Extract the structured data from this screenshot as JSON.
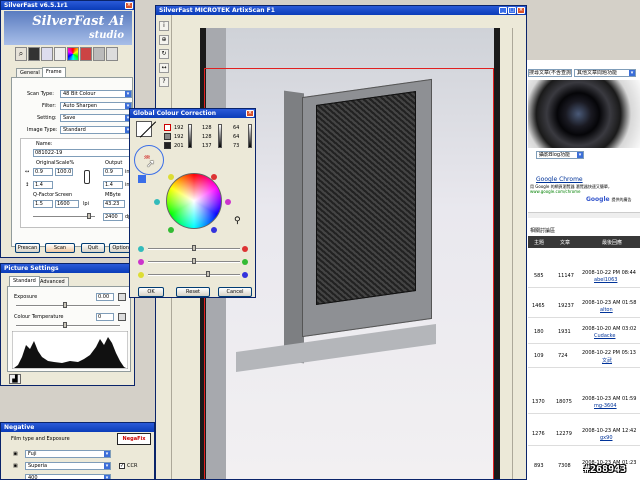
{
  "silverfast": {
    "title": "SilverFast v6.5.1r1",
    "logo_main": "SilverFast Ai",
    "logo_sub": "studio",
    "tabs": [
      "General",
      "Frame"
    ],
    "fields": [
      {
        "label": "Scan Type:",
        "value": "48 Bit Colour"
      },
      {
        "label": "Filter:",
        "value": "Auto Sharpen"
      },
      {
        "label": "Setting:",
        "value": "Save"
      },
      {
        "label": "Image Type:",
        "value": "Standard"
      }
    ],
    "name_label": "Name:",
    "name_value": "081022-19",
    "original_label": "Original",
    "scale_label": "Scale%",
    "output_label": "Output",
    "orig_w": "0.9",
    "scale_val": "100.0",
    "out_w": "0.9",
    "orig_h": "1.4",
    "out_h": "1.4",
    "unit": "inch",
    "qfactor_label": "Q-Factor",
    "screen_label": "Screen",
    "mbyte_label": "MByte",
    "qfactor": "1.5",
    "screen": "1600",
    "lpi": "lpi",
    "mbyte": "43.23",
    "dpi_val": "2400",
    "dpi": "dpi",
    "buttons": [
      "Prescan",
      "Scan",
      "Quit",
      "Options"
    ]
  },
  "picture_settings": {
    "title": "Picture Settings",
    "tabs": [
      "Standard",
      "Advanced"
    ],
    "exposure_label": "Exposure",
    "exposure_value": "0.00",
    "temp_label": "Colour Temperature",
    "temp_value": "0"
  },
  "negative": {
    "title": "Negative",
    "section": "Film type and Exposure",
    "brand": "NegaFix",
    "maker": "Fuji",
    "film": "Superia",
    "ccr": "CCR",
    "third": "400"
  },
  "prescan": {
    "title": "SilverFast MICROTEK ArtixScan F1"
  },
  "gcc": {
    "title": "Global Colour Correction",
    "rows": [
      [
        "192",
        "128",
        "64"
      ],
      [
        "192",
        "128",
        "64"
      ],
      [
        "201",
        "137",
        "73"
      ]
    ],
    "buttons": [
      "OK",
      "Reset",
      "Cancel"
    ]
  },
  "browser": {
    "search_box": "搜尋文章(不含查詢)",
    "search_option": "其他文章問題功能",
    "select_label": "攝影Blog功能",
    "google_title": "Google Chrome",
    "google_line1": "用 Google 的網頁瀏覽器 瀏覽器快速又簡單，",
    "google_line2": "www.google.com/chrome",
    "google_brand": "Google",
    "google_ad": "提供的廣告",
    "section_title": "相關討論區",
    "headers": [
      "主題",
      "文章",
      "最後回應"
    ],
    "rows": [
      {
        "a": "585",
        "b": "11147",
        "date": "2008-10-22 PM 08:44",
        "user": "abel1063"
      },
      {
        "a": "1465",
        "b": "19237",
        "date": "2008-10-23 AM 01:58",
        "user": "alton"
      },
      {
        "a": "180",
        "b": "1931",
        "date": "2008-10-20 AM 03:02",
        "user": "Cudacke"
      },
      {
        "a": "109",
        "b": "724",
        "date": "2008-10-22 PM 05:13",
        "user": "文武"
      },
      {
        "a": "1370",
        "b": "18075",
        "date": "2008-10-23 AM 01:59",
        "user": "mg-3604"
      },
      {
        "a": "1276",
        "b": "12279",
        "date": "2008-10-23 AM 12:42",
        "user": "gx90"
      },
      {
        "a": "893",
        "b": "7308",
        "date": "2008-10-23 AM 01:23",
        "user": ""
      }
    ],
    "watermark": "#268943"
  }
}
